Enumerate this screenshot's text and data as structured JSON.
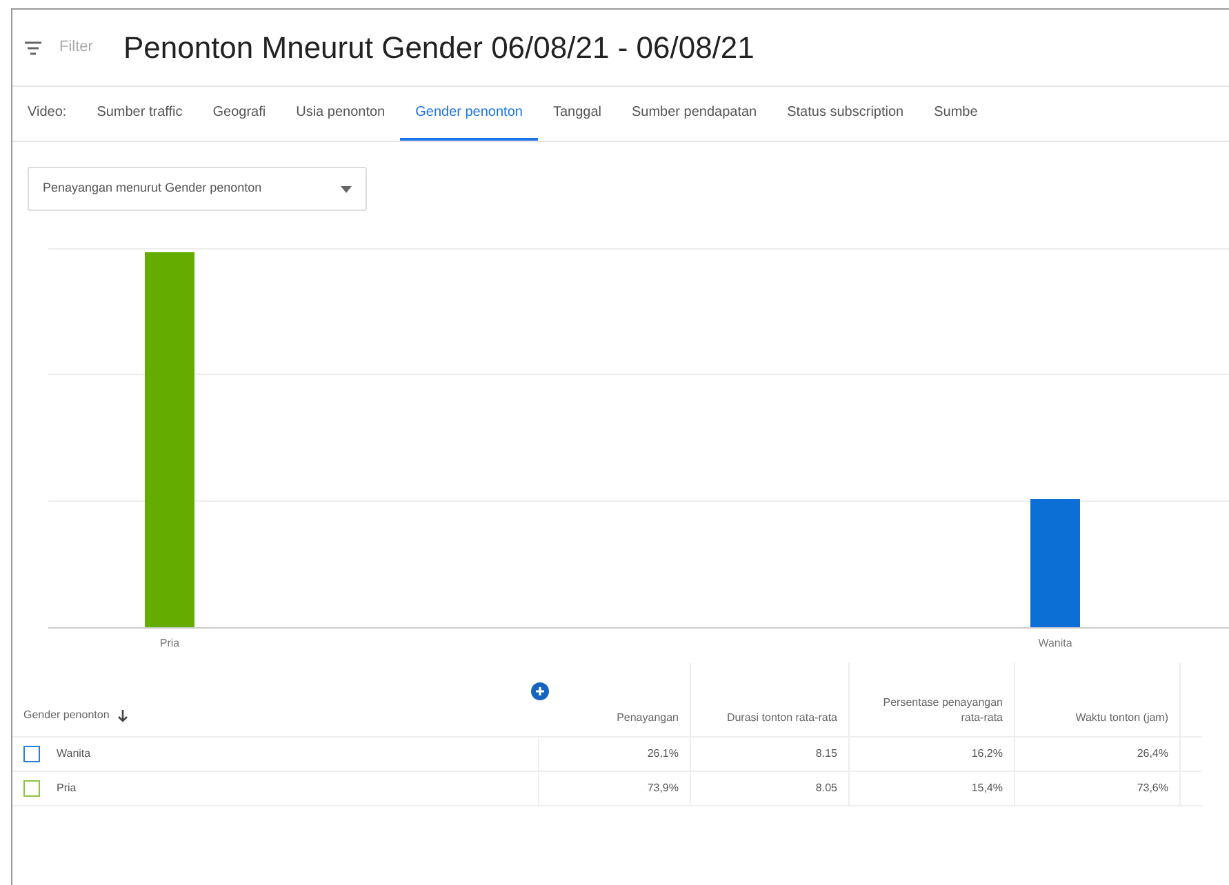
{
  "header": {
    "filter_label": "Filter",
    "title": "Penonton Mneurut Gender 06/08/21 - 06/08/21"
  },
  "tabs": [
    {
      "label": "Video:",
      "selected": false
    },
    {
      "label": "Sumber traffic",
      "selected": false
    },
    {
      "label": "Geografi",
      "selected": false
    },
    {
      "label": "Usia penonton",
      "selected": false
    },
    {
      "label": "Gender penonton",
      "selected": true
    },
    {
      "label": "Tanggal",
      "selected": false
    },
    {
      "label": "Sumber pendapatan",
      "selected": false
    },
    {
      "label": "Status subscription",
      "selected": false
    },
    {
      "label": "Sumbe",
      "selected": false
    }
  ],
  "metric_dropdown": {
    "value": "Penayangan menurut Gender penonton"
  },
  "chart": {
    "bars": [
      {
        "label": "Pria",
        "color": "#64ad00"
      },
      {
        "label": "Wanita",
        "color": "#0b6fd6"
      }
    ]
  },
  "table": {
    "columns": [
      {
        "label": "Gender penonton",
        "sorted": true
      },
      {
        "label": "Penayangan"
      },
      {
        "label": "Durasi tonton rata-rata"
      },
      {
        "label": "Persentase penayangan rata-rata"
      },
      {
        "label": "Waktu tonton (jam)"
      }
    ],
    "rows": [
      {
        "color": "#2a7fd4",
        "checked": false,
        "cells": [
          "Wanita",
          "26,1%",
          "8.15",
          "16,2%",
          "26,4%"
        ]
      },
      {
        "color": "#8cc43c",
        "checked": false,
        "cells": [
          "Pria",
          "73,9%",
          "8.05",
          "15,4%",
          "73,6%"
        ]
      }
    ]
  }
}
